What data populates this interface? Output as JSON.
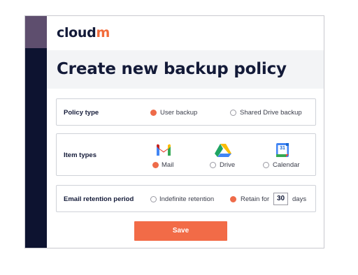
{
  "brand": {
    "prefix": "cloud",
    "suffix": "m"
  },
  "page_title": "Create new backup policy",
  "policy_type": {
    "label": "Policy type",
    "options": [
      {
        "label": "User backup",
        "checked": true
      },
      {
        "label": "Shared Drive backup",
        "checked": false
      }
    ]
  },
  "item_types": {
    "label": "Item types",
    "options": [
      {
        "label": "Mail",
        "icon": "gmail-icon",
        "checked": true
      },
      {
        "label": "Drive",
        "icon": "google-drive-icon",
        "checked": false
      },
      {
        "label": "Calendar",
        "icon": "google-calendar-icon",
        "checked": false
      }
    ],
    "calendar_day": "31"
  },
  "email_retention": {
    "label": "Email retention period",
    "options": [
      {
        "label": "Indefinite retention",
        "checked": false
      },
      {
        "label": "Retain for",
        "checked": true
      }
    ],
    "days_value": "30",
    "days_unit": "days"
  },
  "save_label": "Save",
  "colors": {
    "accent": "#f26b47",
    "rail": "#0d1330",
    "rail_top": "#5e4e6e",
    "header_band": "#f3f4f6"
  }
}
